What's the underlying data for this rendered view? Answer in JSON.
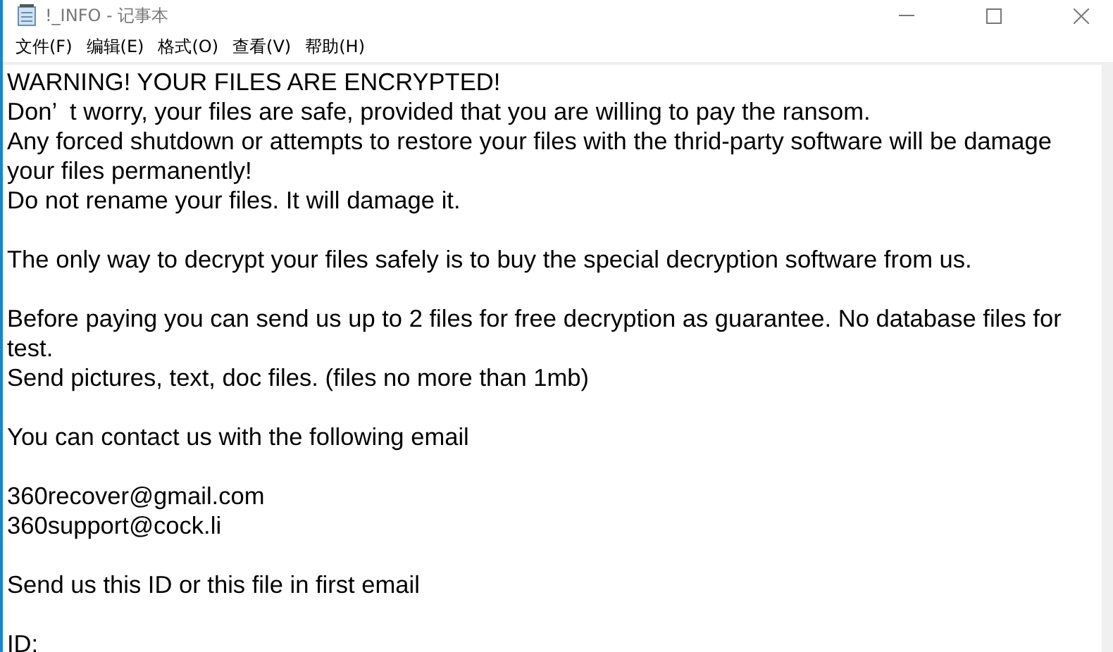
{
  "window": {
    "title": "!_INFO - 记事本"
  },
  "menu": [
    {
      "label": "文件(F)"
    },
    {
      "label": "编辑(E)"
    },
    {
      "label": "格式(O)"
    },
    {
      "label": "查看(V)"
    },
    {
      "label": "帮助(H)"
    }
  ],
  "document": {
    "paragraphs": [
      [
        "WARNING! YOUR FILES ARE ENCRYPTED!",
        "Don’  t worry, your files are safe, provided that you are willing to pay the ransom.",
        "Any forced shutdown or attempts to restore your files with the thrid-party software will be damage your files permanently!",
        "Do not rename your files. It will damage it."
      ],
      [
        "The only way to decrypt your files safely is to buy the special decryption software from us."
      ],
      [
        "Before paying you can send us up to 2 files for free decryption as guarantee. No database files for test.",
        "Send pictures, text, doc files. (files no more than 1mb)"
      ],
      [
        "You can contact us with the following email"
      ],
      [
        "360recover@gmail.com",
        "360support@cock.li"
      ],
      [
        "Send us this ID or this file in first email"
      ],
      [
        "ID:"
      ]
    ]
  }
}
